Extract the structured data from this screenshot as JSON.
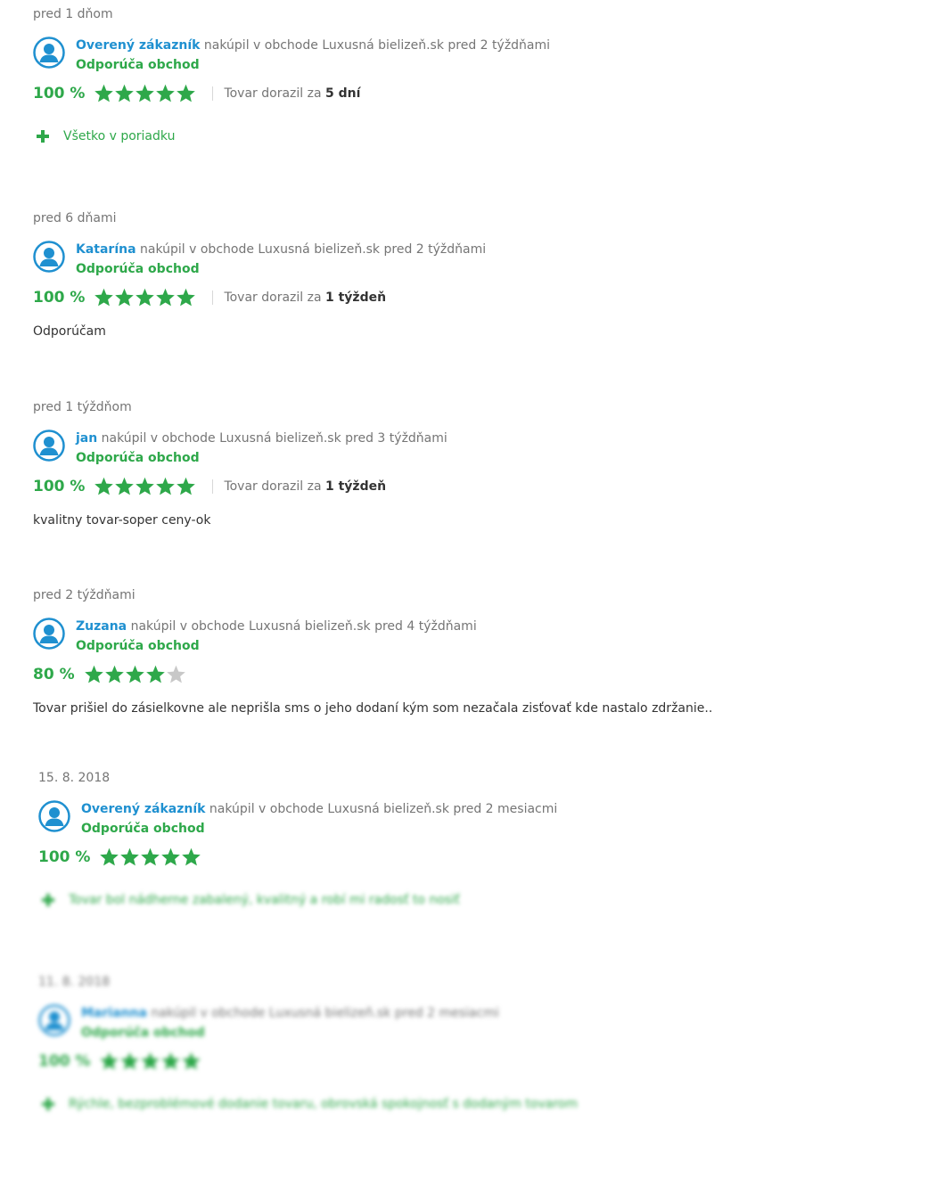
{
  "colors": {
    "accent_green": "#2ea84a",
    "user_blue": "#1f90d0",
    "star_empty": "#c8c8c8"
  },
  "icons": {
    "avatar": "user-circle-icon",
    "star": "star-icon",
    "plus": "plus-icon"
  },
  "reviews": [
    {
      "date": "pred 1 dňom",
      "user": "Overený zákazník",
      "purchase": "nakúpil v obchode Luxusná bielizeň.sk pred 2 týždňami",
      "recommend": "Odporúča obchod",
      "percent": "100 %",
      "stars": 5,
      "delivery_prefix": "Tovar dorazil za",
      "delivery_value": "5 dní",
      "pro": "Všetko v poriadku"
    },
    {
      "date": "pred 6 dňami",
      "user": "Katarína",
      "purchase": "nakúpil v obchode Luxusná bielizeň.sk pred 2 týždňami",
      "recommend": "Odporúča obchod",
      "percent": "100 %",
      "stars": 5,
      "delivery_prefix": "Tovar dorazil za",
      "delivery_value": "1 týždeň",
      "comment": "Odporúčam"
    },
    {
      "date": "pred 1 týždňom",
      "user": "jan",
      "purchase": "nakúpil v obchode Luxusná bielizeň.sk pred 3 týždňami",
      "recommend": "Odporúča obchod",
      "percent": "100 %",
      "stars": 5,
      "delivery_prefix": "Tovar dorazil za",
      "delivery_value": "1 týždeň",
      "comment": "kvalitny tovar-soper ceny-ok"
    },
    {
      "date": "pred 2 týždňami",
      "user": "Zuzana",
      "purchase": "nakúpil v obchode Luxusná bielizeň.sk pred 4 týždňami",
      "recommend": "Odporúča obchod",
      "percent": "80 %",
      "stars": 4,
      "comment": "Tovar prišiel do zásielkovne ale neprišla sms o jeho dodaní kým som nezačala zisťovať kde nastalo zdržanie.."
    },
    {
      "date": "15. 8. 2018",
      "user": "Overený zákazník",
      "purchase": "nakúpil v obchode Luxusná bielizeň.sk pred 2 mesiacmi",
      "recommend": "Odporúča obchod",
      "percent": "100 %",
      "stars": 5,
      "pro": "Tovar bol nádherne zabalený, kvalitný a robí mi radosť to nosiť"
    },
    {
      "date": "11. 8. 2018",
      "user": "Marianna",
      "purchase": "nakúpil v obchode Luxusná bielizeň.sk pred 2 mesiacmi",
      "recommend": "Odporúča obchod",
      "percent": "100 %",
      "stars": 5,
      "pro": "Rýchle, bezproblémové dodanie tovaru, obrovská spokojnosť s dodaným tovarom"
    }
  ]
}
